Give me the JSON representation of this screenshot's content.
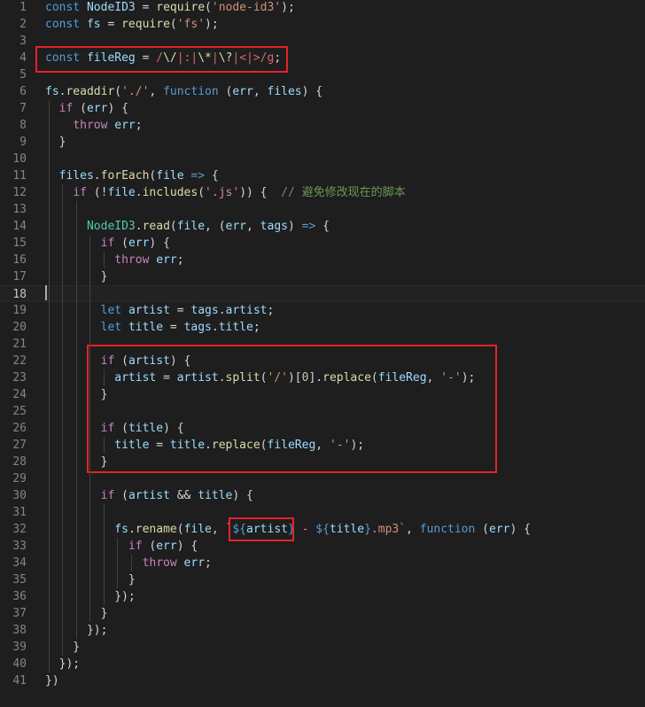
{
  "editor": {
    "active_line": 18,
    "lines": [
      {
        "n": "1",
        "t": [
          [
            "kw",
            "const"
          ],
          [
            "pl",
            " "
          ],
          [
            "var",
            "NodeID3"
          ],
          [
            "pl",
            " = "
          ],
          [
            "fn",
            "require"
          ],
          [
            "pl",
            "("
          ],
          [
            "str",
            "'node-id3'"
          ],
          [
            "pl",
            ");"
          ]
        ]
      },
      {
        "n": "2",
        "t": [
          [
            "kw",
            "const"
          ],
          [
            "pl",
            " "
          ],
          [
            "var",
            "fs"
          ],
          [
            "pl",
            " = "
          ],
          [
            "fn",
            "require"
          ],
          [
            "pl",
            "("
          ],
          [
            "str",
            "'fs'"
          ],
          [
            "pl",
            ");"
          ]
        ]
      },
      {
        "n": "3",
        "t": []
      },
      {
        "n": "4",
        "t": [
          [
            "kw",
            "const"
          ],
          [
            "pl",
            " "
          ],
          [
            "var",
            "fileReg"
          ],
          [
            "pl",
            " = "
          ],
          [
            "rx",
            "/"
          ],
          [
            "rxo",
            "\\/"
          ],
          [
            "rx",
            "|"
          ],
          [
            "rx",
            ":"
          ],
          [
            "rx",
            "|"
          ],
          [
            "rxo",
            "\\*"
          ],
          [
            "rx",
            "|"
          ],
          [
            "rxo",
            "\\?"
          ],
          [
            "rx",
            "|"
          ],
          [
            "rx",
            "<"
          ],
          [
            "rx",
            "|"
          ],
          [
            "rx",
            ">"
          ],
          [
            "rx",
            "/g"
          ],
          [
            "pl",
            ";"
          ]
        ]
      },
      {
        "n": "5",
        "t": []
      },
      {
        "n": "6",
        "t": [
          [
            "var",
            "fs"
          ],
          [
            "pl",
            "."
          ],
          [
            "fn",
            "readdir"
          ],
          [
            "pl",
            "("
          ],
          [
            "str",
            "'./'"
          ],
          [
            "pl",
            ", "
          ],
          [
            "kw",
            "function"
          ],
          [
            "pl",
            " ("
          ],
          [
            "var",
            "err"
          ],
          [
            "pl",
            ", "
          ],
          [
            "var",
            "files"
          ],
          [
            "pl",
            ") {"
          ]
        ]
      },
      {
        "n": "7",
        "t": [
          [
            "pl",
            "  "
          ],
          [
            "ctl",
            "if"
          ],
          [
            "pl",
            " ("
          ],
          [
            "var",
            "err"
          ],
          [
            "pl",
            ") {"
          ]
        ]
      },
      {
        "n": "8",
        "t": [
          [
            "pl",
            "    "
          ],
          [
            "ctl",
            "throw"
          ],
          [
            "pl",
            " "
          ],
          [
            "var",
            "err"
          ],
          [
            "pl",
            ";"
          ]
        ]
      },
      {
        "n": "9",
        "t": [
          [
            "pl",
            "  }"
          ]
        ]
      },
      {
        "n": "10",
        "t": []
      },
      {
        "n": "11",
        "t": [
          [
            "pl",
            "  "
          ],
          [
            "var",
            "files"
          ],
          [
            "pl",
            "."
          ],
          [
            "fn",
            "forEach"
          ],
          [
            "pl",
            "("
          ],
          [
            "var",
            "file"
          ],
          [
            "pl",
            " "
          ],
          [
            "kw",
            "=>"
          ],
          [
            "pl",
            " {"
          ]
        ]
      },
      {
        "n": "12",
        "t": [
          [
            "pl",
            "    "
          ],
          [
            "ctl",
            "if"
          ],
          [
            "pl",
            " (!"
          ],
          [
            "var",
            "file"
          ],
          [
            "pl",
            "."
          ],
          [
            "fn",
            "includes"
          ],
          [
            "pl",
            "("
          ],
          [
            "str",
            "'.js'"
          ],
          [
            "pl",
            ")) {  "
          ],
          [
            "cm",
            "// 避免修改现在的脚本"
          ]
        ]
      },
      {
        "n": "13",
        "t": []
      },
      {
        "n": "14",
        "t": [
          [
            "pl",
            "      "
          ],
          [
            "cls",
            "NodeID3"
          ],
          [
            "pl",
            "."
          ],
          [
            "fn",
            "read"
          ],
          [
            "pl",
            "("
          ],
          [
            "var",
            "file"
          ],
          [
            "pl",
            ", ("
          ],
          [
            "var",
            "err"
          ],
          [
            "pl",
            ", "
          ],
          [
            "var",
            "tags"
          ],
          [
            "pl",
            ") "
          ],
          [
            "kw",
            "=>"
          ],
          [
            "pl",
            " {"
          ]
        ]
      },
      {
        "n": "15",
        "t": [
          [
            "pl",
            "        "
          ],
          [
            "ctl",
            "if"
          ],
          [
            "pl",
            " ("
          ],
          [
            "var",
            "err"
          ],
          [
            "pl",
            ") {"
          ]
        ]
      },
      {
        "n": "16",
        "t": [
          [
            "pl",
            "          "
          ],
          [
            "ctl",
            "throw"
          ],
          [
            "pl",
            " "
          ],
          [
            "var",
            "err"
          ],
          [
            "pl",
            ";"
          ]
        ]
      },
      {
        "n": "17",
        "t": [
          [
            "pl",
            "        }"
          ]
        ]
      },
      {
        "n": "18",
        "t": []
      },
      {
        "n": "19",
        "t": [
          [
            "pl",
            "        "
          ],
          [
            "kw",
            "let"
          ],
          [
            "pl",
            " "
          ],
          [
            "var",
            "artist"
          ],
          [
            "pl",
            " = "
          ],
          [
            "var",
            "tags"
          ],
          [
            "pl",
            "."
          ],
          [
            "var",
            "artist"
          ],
          [
            "pl",
            ";"
          ]
        ]
      },
      {
        "n": "20",
        "t": [
          [
            "pl",
            "        "
          ],
          [
            "kw",
            "let"
          ],
          [
            "pl",
            " "
          ],
          [
            "var",
            "title"
          ],
          [
            "pl",
            " = "
          ],
          [
            "var",
            "tags"
          ],
          [
            "pl",
            "."
          ],
          [
            "var",
            "title"
          ],
          [
            "pl",
            ";"
          ]
        ]
      },
      {
        "n": "21",
        "t": []
      },
      {
        "n": "22",
        "t": [
          [
            "pl",
            "        "
          ],
          [
            "ctl",
            "if"
          ],
          [
            "pl",
            " ("
          ],
          [
            "var",
            "artist"
          ],
          [
            "pl",
            ") {"
          ]
        ]
      },
      {
        "n": "23",
        "t": [
          [
            "pl",
            "          "
          ],
          [
            "var",
            "artist"
          ],
          [
            "pl",
            " = "
          ],
          [
            "var",
            "artist"
          ],
          [
            "pl",
            "."
          ],
          [
            "fn",
            "split"
          ],
          [
            "pl",
            "("
          ],
          [
            "str",
            "'/'"
          ],
          [
            "pl",
            ")["
          ],
          [
            "num",
            "0"
          ],
          [
            "pl",
            "]."
          ],
          [
            "fn",
            "replace"
          ],
          [
            "pl",
            "("
          ],
          [
            "var",
            "fileReg"
          ],
          [
            "pl",
            ", "
          ],
          [
            "str",
            "'-'"
          ],
          [
            "pl",
            ");"
          ]
        ]
      },
      {
        "n": "24",
        "t": [
          [
            "pl",
            "        }"
          ]
        ]
      },
      {
        "n": "25",
        "t": []
      },
      {
        "n": "26",
        "t": [
          [
            "pl",
            "        "
          ],
          [
            "ctl",
            "if"
          ],
          [
            "pl",
            " ("
          ],
          [
            "var",
            "title"
          ],
          [
            "pl",
            ") {"
          ]
        ]
      },
      {
        "n": "27",
        "t": [
          [
            "pl",
            "          "
          ],
          [
            "var",
            "title"
          ],
          [
            "pl",
            " = "
          ],
          [
            "var",
            "title"
          ],
          [
            "pl",
            "."
          ],
          [
            "fn",
            "replace"
          ],
          [
            "pl",
            "("
          ],
          [
            "var",
            "fileReg"
          ],
          [
            "pl",
            ", "
          ],
          [
            "str",
            "'-'"
          ],
          [
            "pl",
            ");"
          ]
        ]
      },
      {
        "n": "28",
        "t": [
          [
            "pl",
            "        }"
          ]
        ]
      },
      {
        "n": "29",
        "t": []
      },
      {
        "n": "30",
        "t": [
          [
            "pl",
            "        "
          ],
          [
            "ctl",
            "if"
          ],
          [
            "pl",
            " ("
          ],
          [
            "var",
            "artist"
          ],
          [
            "pl",
            " && "
          ],
          [
            "var",
            "title"
          ],
          [
            "pl",
            ") {"
          ]
        ]
      },
      {
        "n": "31",
        "t": []
      },
      {
        "n": "32",
        "t": [
          [
            "pl",
            "          "
          ],
          [
            "var",
            "fs"
          ],
          [
            "pl",
            "."
          ],
          [
            "fn",
            "rename"
          ],
          [
            "pl",
            "("
          ],
          [
            "var",
            "file"
          ],
          [
            "pl",
            ", "
          ],
          [
            "str",
            "`"
          ],
          [
            "tpl",
            "${"
          ],
          [
            "var",
            "artist"
          ],
          [
            "tpl",
            "}"
          ],
          [
            "str",
            " - "
          ],
          [
            "tpl",
            "${"
          ],
          [
            "var",
            "title"
          ],
          [
            "tpl",
            "}"
          ],
          [
            "str",
            ".mp3`"
          ],
          [
            "pl",
            ", "
          ],
          [
            "kw",
            "function"
          ],
          [
            "pl",
            " ("
          ],
          [
            "var",
            "err"
          ],
          [
            "pl",
            ") {"
          ]
        ]
      },
      {
        "n": "33",
        "t": [
          [
            "pl",
            "            "
          ],
          [
            "ctl",
            "if"
          ],
          [
            "pl",
            " ("
          ],
          [
            "var",
            "err"
          ],
          [
            "pl",
            ") {"
          ]
        ]
      },
      {
        "n": "34",
        "t": [
          [
            "pl",
            "              "
          ],
          [
            "ctl",
            "throw"
          ],
          [
            "pl",
            " "
          ],
          [
            "var",
            "err"
          ],
          [
            "pl",
            ";"
          ]
        ]
      },
      {
        "n": "35",
        "t": [
          [
            "pl",
            "            }"
          ]
        ]
      },
      {
        "n": "36",
        "t": [
          [
            "pl",
            "          });"
          ]
        ]
      },
      {
        "n": "37",
        "t": [
          [
            "pl",
            "        }"
          ]
        ]
      },
      {
        "n": "38",
        "t": [
          [
            "pl",
            "      });"
          ]
        ]
      },
      {
        "n": "39",
        "t": [
          [
            "pl",
            "    }"
          ]
        ]
      },
      {
        "n": "40",
        "t": [
          [
            "pl",
            "  });"
          ]
        ]
      },
      {
        "n": "41",
        "t": [
          [
            "pl",
            "})"
          ]
        ]
      }
    ]
  },
  "colors": {
    "background": "#1e1e1e",
    "highlight_box": "#e5222a"
  }
}
